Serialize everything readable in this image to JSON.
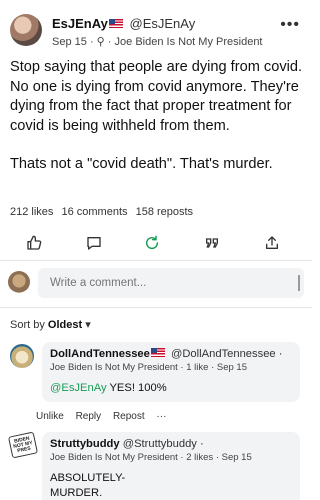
{
  "post": {
    "author_name": "EsJEnAy",
    "author_handle": "@EsJEnAy",
    "date": "Sep 15",
    "group": "Joe Biden Is Not My President",
    "body_p1": "Stop saying that people are dying from covid. No one is dying from covid anymore. They're dying from the fact that proper treatment for covid is being withheld from them.",
    "body_p2": "Thats not a \"covid death\". That's murder.",
    "likes": "212 likes",
    "comments": "16 comments",
    "reposts": "158 reposts"
  },
  "actions": {
    "like_icon": "thumbs-up-icon",
    "comment_icon": "speech-bubble-icon",
    "repost_icon": "repost-icon",
    "quote_icon": "quote-icon",
    "share_icon": "share-icon",
    "accent": "#1a9c57"
  },
  "composer": {
    "placeholder": "Write a comment..."
  },
  "sort": {
    "label": "Sort by",
    "value": "Oldest"
  },
  "comments": [
    {
      "author_name": "DollAndTennessee",
      "author_handle": "@DollAndTennessee",
      "group": "Joe Biden Is Not My President",
      "likes": "1 like",
      "date": "Sep 15",
      "mention": "@EsJEnAy",
      "text": " YES! 100%",
      "unlike": "Unlike",
      "reply": "Reply",
      "repost": "Repost",
      "more": "···"
    },
    {
      "author_name": "Struttybuddy",
      "author_handle": "@Struttybuddy",
      "group": "Joe Biden Is Not My President",
      "likes": "2 likes",
      "date": "Sep 15",
      "text_line1": "ABSOLUTELY-",
      "text_line2": "MURDER.",
      "sticker_text": "BIDEN NOT MY PRES"
    }
  ]
}
